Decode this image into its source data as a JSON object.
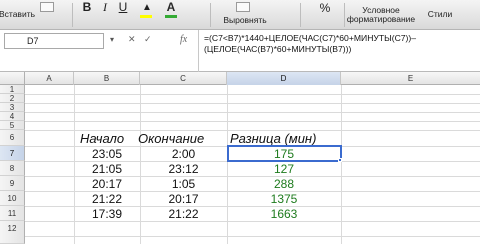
{
  "ribbon": {
    "paste_label": "Вставить",
    "bold_label": "B",
    "italic_label": "I",
    "underline_label": "U",
    "font_color_label": "A",
    "align_label": "Выровнять",
    "percent_label": "%",
    "conditional_format_label": "Условное\nформатирование",
    "styles_label": "Стили",
    "fill_color": "#ffff00",
    "font_color": "#33aa33"
  },
  "formula_bar": {
    "cell_ref": "D7",
    "fx_label": "fx",
    "formula": "=(C7<B7)*1440+ЦЕЛОЕ(ЧАС(C7)*60+МИНУТЫ(C7))–\n(ЦЕЛОЕ(ЧАС(B7)*60+МИНУТЫ(B7)))"
  },
  "sheet": {
    "columns": [
      "A",
      "B",
      "C",
      "D",
      "E"
    ],
    "rows": [
      "1",
      "2",
      "3",
      "4",
      "5",
      "6",
      "7",
      "8",
      "9",
      "10",
      "11",
      "12"
    ],
    "headers": {
      "start": "Начало",
      "end": "Окончание",
      "diff": "Разница (мин)"
    },
    "data": [
      {
        "start": "23:05",
        "end": "2:00",
        "diff": "175"
      },
      {
        "start": "21:05",
        "end": "23:12",
        "diff": "127"
      },
      {
        "start": "20:17",
        "end": "1:05",
        "diff": "288"
      },
      {
        "start": "21:22",
        "end": "20:17",
        "diff": "1375"
      },
      {
        "start": "17:39",
        "end": "21:22",
        "diff": "1663"
      }
    ],
    "active_cell": "D7",
    "diff_color": "#1e7b1e",
    "selection_color": "#3b6bcf"
  }
}
